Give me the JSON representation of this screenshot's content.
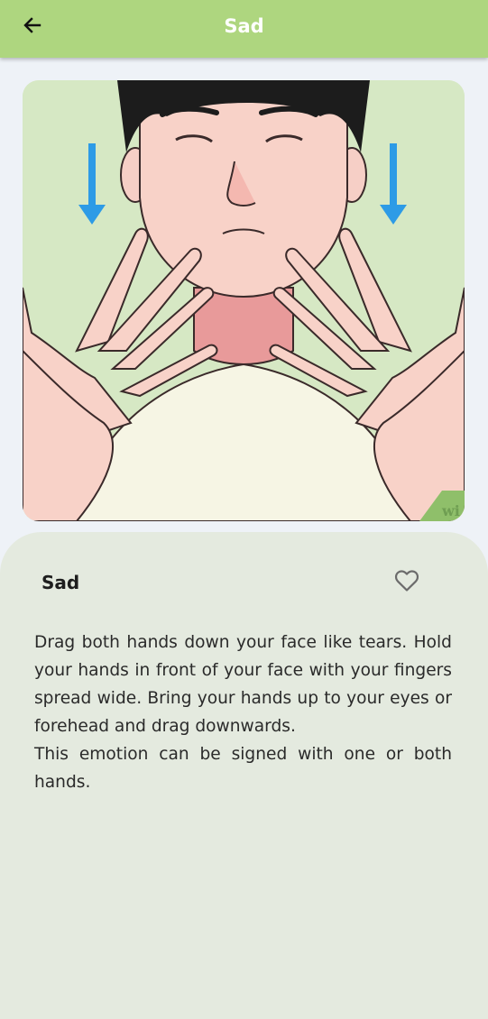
{
  "appbar": {
    "title": "Sad",
    "back_icon": "arrow-left-icon",
    "background_color": "#aed67f"
  },
  "illustration": {
    "watermark": "wi"
  },
  "detail": {
    "name": "Sad",
    "favorite_icon": "heart-outline-icon",
    "description": [
      "Drag both hands down your face like tears. Hold your hands in front of your face with your fingers spread wide. Bring your hands up to your eyes or forehead and drag downwards.",
      "This emotion can be signed with one or both hands."
    ]
  }
}
